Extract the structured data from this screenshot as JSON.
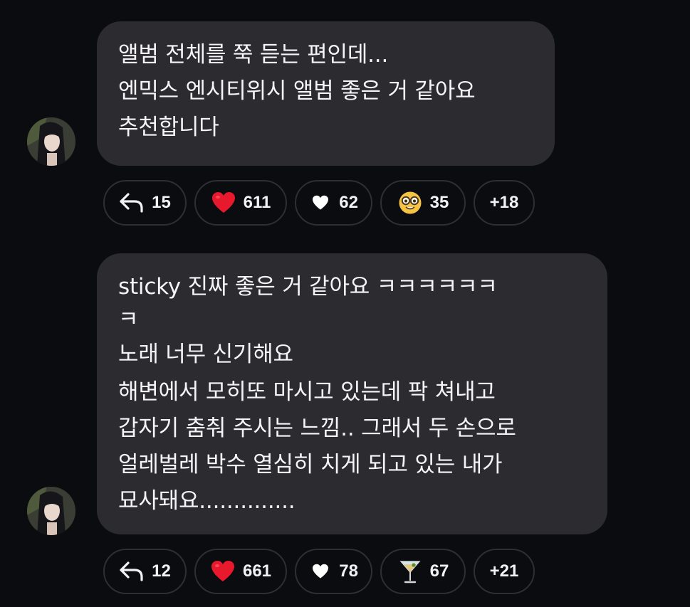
{
  "messages": [
    {
      "lines": [
        "앨범 전체를 쭉 듣는 편인데...",
        "엔믹스 엔시티위시 앨범 좋은 거 같아요",
        "추천합니다"
      ],
      "reactions": {
        "reply": {
          "icon": "reply-arrow-icon",
          "count": "15"
        },
        "red_heart": {
          "icon": "red-heart-icon",
          "count": "611"
        },
        "white_heart": {
          "icon": "white-heart-icon",
          "count": "62"
        },
        "emoji": {
          "icon": "nerd-face-icon",
          "count": "35"
        },
        "more": {
          "label": "+18"
        }
      }
    },
    {
      "lines": [
        "sticky 진짜 좋은 거 같아요 ㅋㅋㅋㅋㅋㅋ",
        "ㅋ",
        "노래 너무 신기해요",
        "해변에서 모히또 마시고 있는데 팍 쳐내고",
        "갑자기 춤춰 주시는 느낌.. 그래서 두 손으로",
        "얼레벌레 박수 열심히 치게 되고 있는 내가",
        "묘사돼요.............."
      ],
      "reactions": {
        "reply": {
          "icon": "reply-arrow-icon",
          "count": "12"
        },
        "red_heart": {
          "icon": "red-heart-icon",
          "count": "661"
        },
        "white_heart": {
          "icon": "white-heart-icon",
          "count": "78"
        },
        "emoji": {
          "icon": "cocktail-glass-icon",
          "count": "67"
        },
        "more": {
          "label": "+21"
        }
      }
    }
  ],
  "colors": {
    "background": "#0b0c10",
    "bubble": "#2c2c30",
    "chip_border": "#2e2f33",
    "heart_red": "#e8192c"
  }
}
